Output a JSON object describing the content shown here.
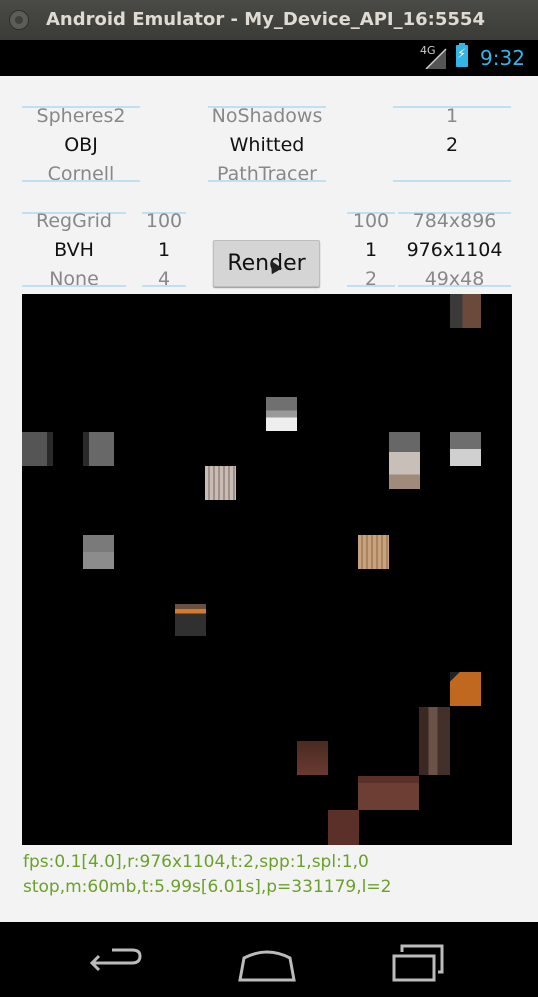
{
  "window": {
    "title": "Android Emulator - My_Device_API_16:5554"
  },
  "status_bar": {
    "network": "4G",
    "time": "9:32",
    "colors": {
      "accent": "#33b5e5"
    }
  },
  "scene_picker": {
    "above": "Spheres2",
    "selected": "OBJ",
    "below": "Cornell"
  },
  "shadow_picker": {
    "above": "NoShadows",
    "selected": "Whitted",
    "below": "PathTracer"
  },
  "count_picker": {
    "above": "1",
    "selected": "2",
    "below": ""
  },
  "accel_picker": {
    "above": "RegGrid",
    "selected": "BVH",
    "below": "None"
  },
  "depth_picker": {
    "above": "100",
    "selected": "1",
    "below": "4"
  },
  "spp_picker": {
    "above": "100",
    "selected": "1",
    "below": "2"
  },
  "resolution_picker": {
    "above": "784x896",
    "selected": "976x1104",
    "below": "49x48"
  },
  "render_button": {
    "label": "Render"
  },
  "stats": {
    "line1": "fps:0.1[4.0],r:976x1104,t:2,spp:1,spl:1,0",
    "line2": "stop,m:60mb,t:5.99s[6.01s],p=331179,l=2",
    "color": "#6aa12a"
  },
  "nav": {
    "back_icon": "back-icon",
    "home_icon": "home-icon",
    "recents_icon": "recents-icon"
  }
}
